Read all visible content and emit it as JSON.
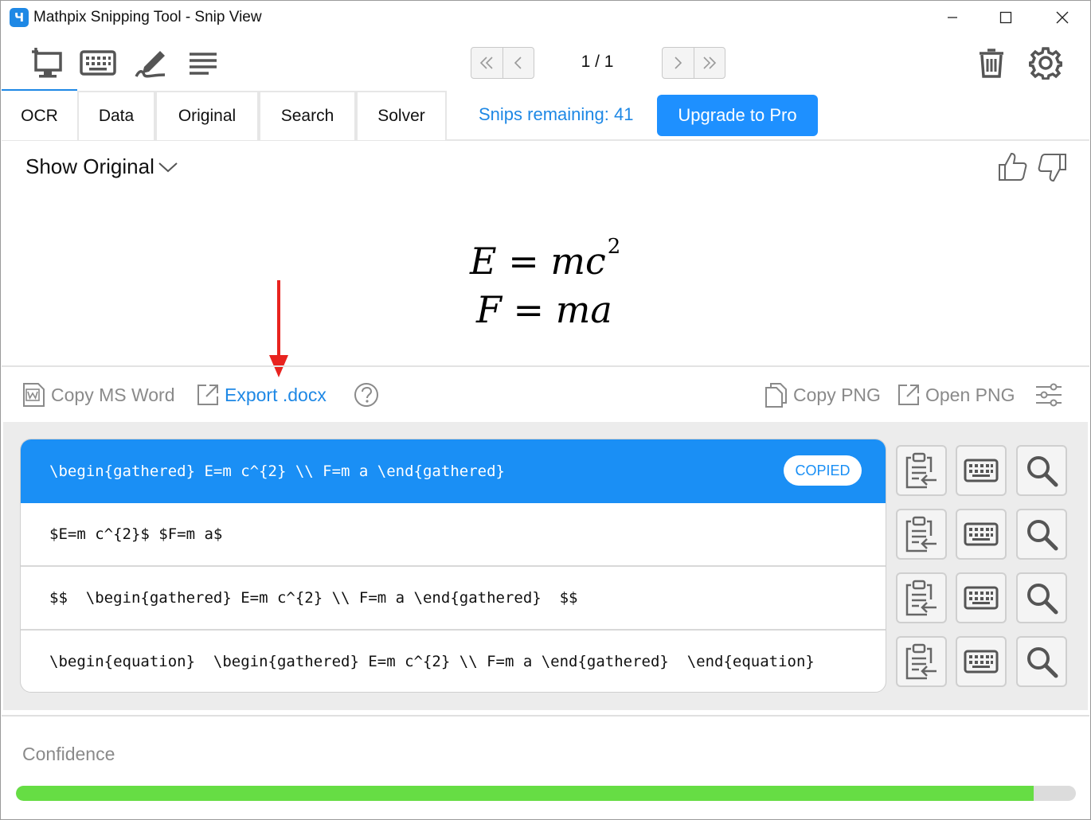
{
  "window": {
    "title": "Mathpix Snipping Tool - Snip View",
    "app_icon_glyph": "Ч"
  },
  "toolbar": {
    "icons": [
      "screen-snip-icon",
      "keyboard-icon",
      "handwriting-icon",
      "list-icon"
    ],
    "page_indicator": "1 / 1",
    "right_icons": [
      "trash-icon",
      "gear-icon"
    ]
  },
  "tabs": [
    "OCR",
    "Data",
    "Original",
    "Search",
    "Solver"
  ],
  "snips_remaining": "Snips remaining: 41",
  "upgrade_label": "Upgrade to Pro",
  "preview": {
    "show_original": "Show Original",
    "formula_line1_base": "E = mc",
    "formula_line1_exp": "2",
    "formula_line2": "F = ma"
  },
  "actions": {
    "copy_ms_word": "Copy MS Word",
    "export_docx": "Export .docx",
    "copy_png": "Copy PNG",
    "open_png": "Open PNG"
  },
  "results": [
    {
      "text": "\\begin{gathered} E=m c^{2} \\\\ F=m a \\end{gathered}",
      "selected": true,
      "badge": "COPIED"
    },
    {
      "text": "$E=m c^{2}$ $F=m a$"
    },
    {
      "text": "$$  \\begin{gathered} E=m c^{2} \\\\ F=m a \\end{gathered}  $$"
    },
    {
      "text": "\\begin{equation}  \\begin{gathered} E=m c^{2} \\\\ F=m a \\end{gathered}  \\end{equation}"
    }
  ],
  "confidence": {
    "label": "Confidence",
    "value": 0.96
  },
  "colors": {
    "accent": "#1e88e5",
    "selected_row": "#1a8ff5",
    "confidence_bar": "#66dd44",
    "annotation_arrow": "#e8231f"
  }
}
